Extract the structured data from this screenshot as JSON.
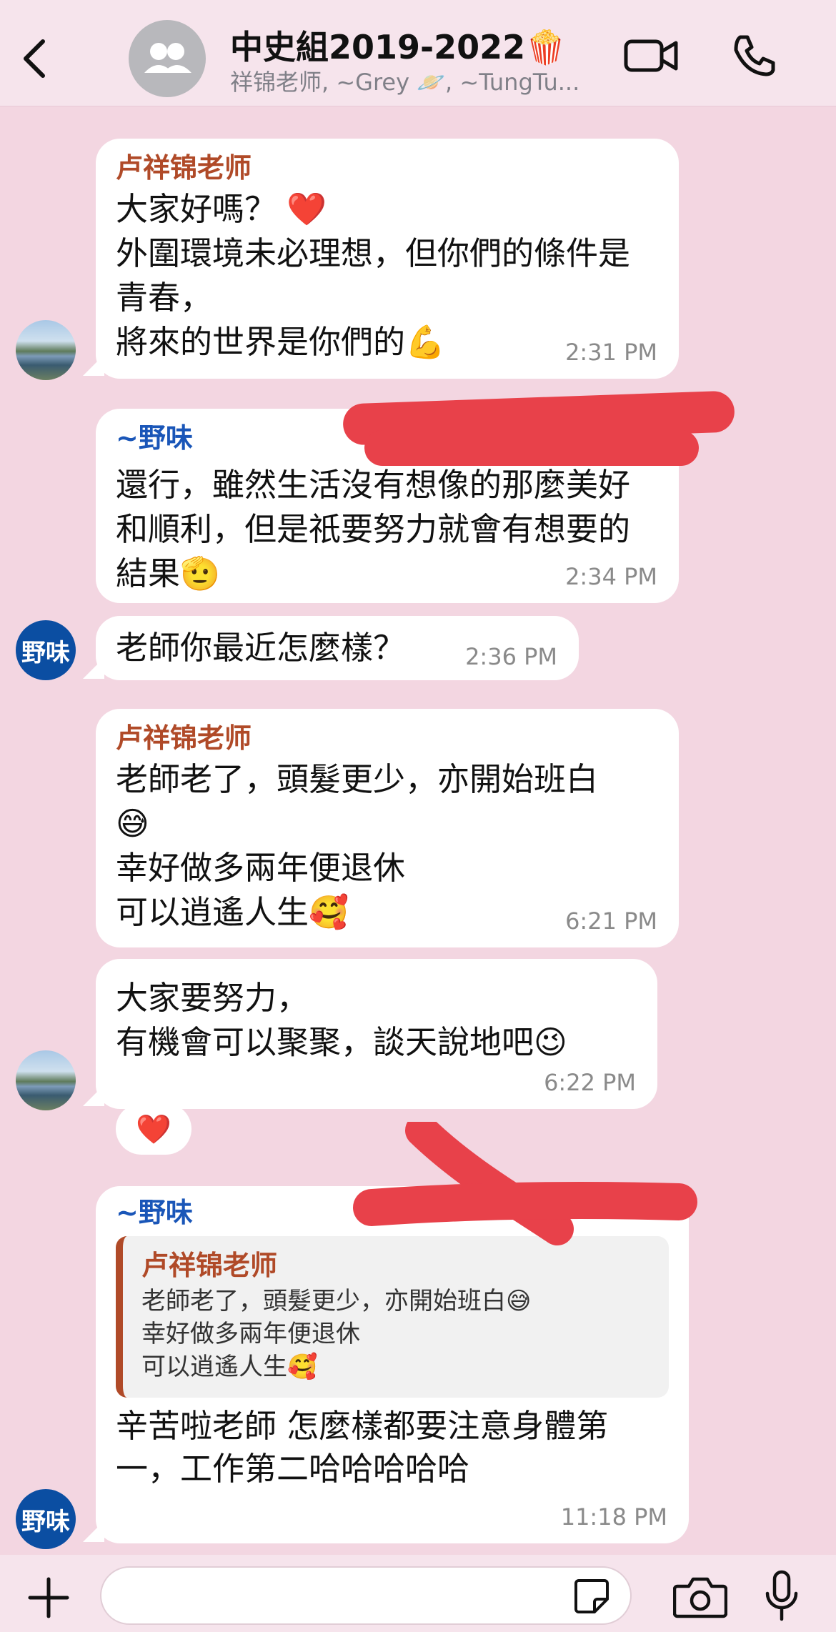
{
  "header": {
    "title": "中史組2019-2022🍿",
    "subtitle": "祥锦老师, ~Grey 🪐, ~TungTu..."
  },
  "messages": [
    {
      "sender": "卢祥锦老师",
      "text": "大家好嗎？ ❤️\n外圍環境未必理想，但你們的條件是青春，\n將來的世界是你們的💪",
      "time": "2:31 PM"
    },
    {
      "sender": "~野味",
      "text": "還行，雖然生活沒有想像的那麼美好和順利，但是祇要努力就會有想要的結果🫡",
      "time": "2:34 PM"
    },
    {
      "sender": "",
      "text": "老師你最近怎麼樣？",
      "time": "2:36 PM"
    },
    {
      "sender": "卢祥锦老师",
      "text": "老師老了，頭髮更少，亦開始班白\n😅\n幸好做多兩年便退休\n可以逍遙人生🥰",
      "time": "6:21 PM"
    },
    {
      "sender": "",
      "text": "大家要努力，\n有機會可以聚聚，談天說地吧😉",
      "time": "6:22 PM",
      "reaction": "❤️"
    },
    {
      "sender": "~野味",
      "quote": {
        "sender": "卢祥锦老师",
        "text": "老師老了，頭髮更少，亦開始班白😅\n幸好做多兩年便退休\n可以逍遙人生🥰"
      },
      "text": "辛苦啦老師 怎麼樣都要注意身體第一，工作第二哈哈哈哈哈",
      "time": "11:18 PM"
    }
  ],
  "avatars": {
    "brand_label": "野味"
  }
}
